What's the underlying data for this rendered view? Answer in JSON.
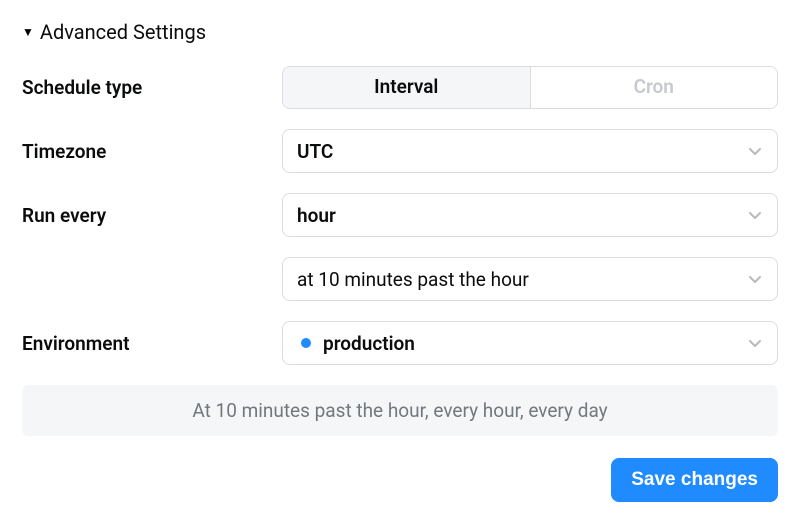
{
  "section": {
    "title": "Advanced Settings"
  },
  "labels": {
    "schedule_type": "Schedule type",
    "timezone": "Timezone",
    "run_every": "Run every",
    "environment": "Environment"
  },
  "schedule_type": {
    "options": [
      "Interval",
      "Cron"
    ],
    "active": "Interval"
  },
  "timezone": {
    "value": "UTC"
  },
  "run_every": {
    "interval_value": "hour",
    "offset_value": "at 10 minutes past the hour"
  },
  "environment": {
    "value": "production",
    "dot_color": "#1f8bff"
  },
  "summary": "At 10 minutes past the hour, every hour, every day",
  "actions": {
    "save": "Save changes"
  }
}
